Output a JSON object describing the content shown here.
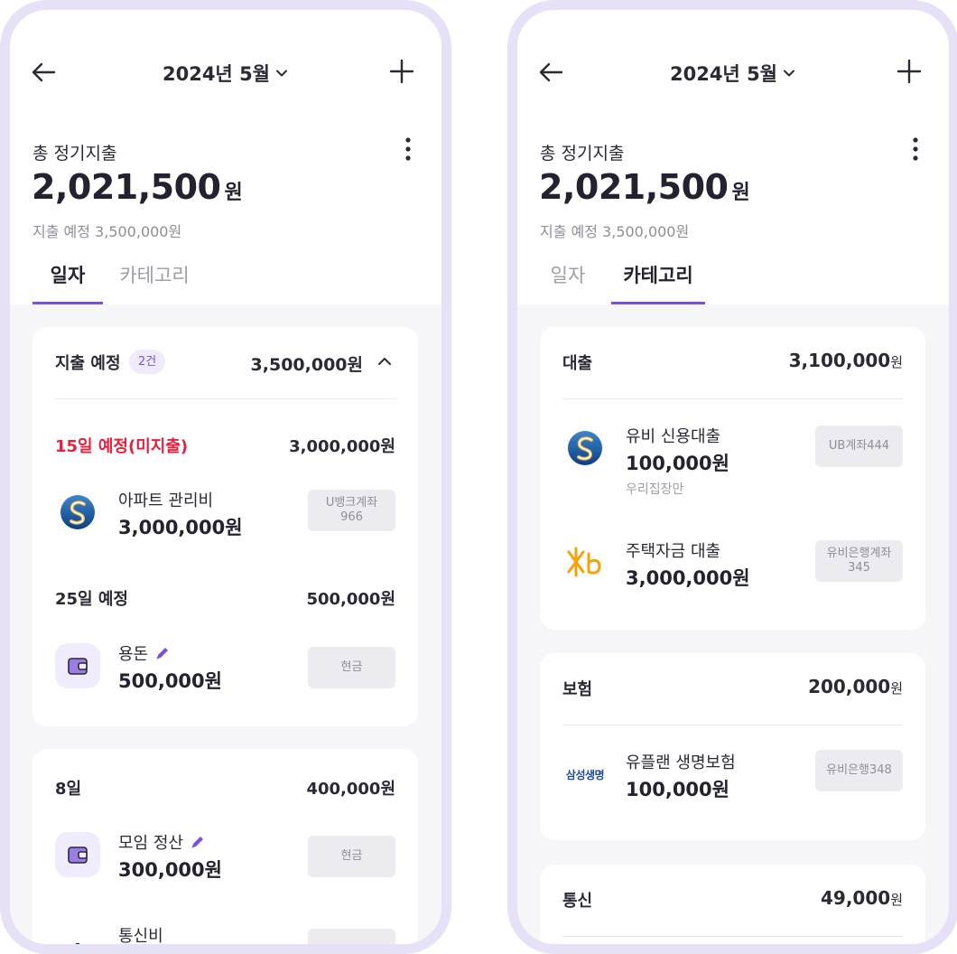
{
  "left": {
    "header": {
      "month": "2024년 5월"
    },
    "summary": {
      "label": "총 정기지출",
      "amount": "2,021,500",
      "unit": "원",
      "sub": "지출 예정 3,500,000원"
    },
    "tabs": [
      {
        "label": "일자"
      },
      {
        "label": "카테고리"
      }
    ],
    "card1": {
      "title": "지출 예정",
      "badge": "2건",
      "total": "3,500,000원",
      "groups": [
        {
          "title": "15일 예정(미지출)",
          "amount": "3,000,000원"
        },
        {
          "title": "25일 예정",
          "amount": "500,000원"
        }
      ],
      "items": [
        {
          "name": "아파트 관리비",
          "amount": "3,000,000원",
          "account": "U뱅크계좌\n966"
        },
        {
          "name": "용돈",
          "amount": "500,000원",
          "account": "현금"
        }
      ]
    },
    "card2": {
      "title": "8일",
      "amount": "400,000원",
      "items": [
        {
          "name": "모임 정산",
          "amount": "300,000원",
          "account": "현금"
        },
        {
          "name": "통신비"
        }
      ]
    }
  },
  "right": {
    "header": {
      "month": "2024년 5월"
    },
    "summary": {
      "label": "총 정기지출",
      "amount": "2,021,500",
      "unit": "원",
      "sub": "지출 예정 3,500,000원"
    },
    "tabs": [
      {
        "label": "일자"
      },
      {
        "label": "카테고리"
      }
    ],
    "cat1": {
      "title": "대출",
      "amount": "3,100,000",
      "unit": "원",
      "items": [
        {
          "name": "유비 신용대출",
          "amount": "100,000원",
          "memo": "우리집장만",
          "account": "UB계좌444"
        },
        {
          "name": "주택자금 대출",
          "amount": "3,000,000원",
          "account": "유비은행계좌\n345"
        }
      ]
    },
    "cat2": {
      "title": "보험",
      "amount": "200,000",
      "unit": "원",
      "items": [
        {
          "name": "유플랜 생명보험",
          "amount": "100,000원",
          "account": "유비은행348",
          "logo_text": "삼성생명"
        }
      ]
    },
    "cat3": {
      "title": "통신",
      "amount": "49,000",
      "unit": "원"
    }
  },
  "colors": {
    "accent": "#7a52d6",
    "danger": "#e8203c",
    "frame": "#e6e1f6"
  },
  "icons": [
    "back-arrow-icon",
    "plus-icon",
    "chevron-down-icon",
    "kebab-menu-icon",
    "chevron-up-icon",
    "shinhan-bank-logo",
    "kb-bank-logo",
    "wallet-icon",
    "pencil-icon",
    "receipt-icon"
  ]
}
